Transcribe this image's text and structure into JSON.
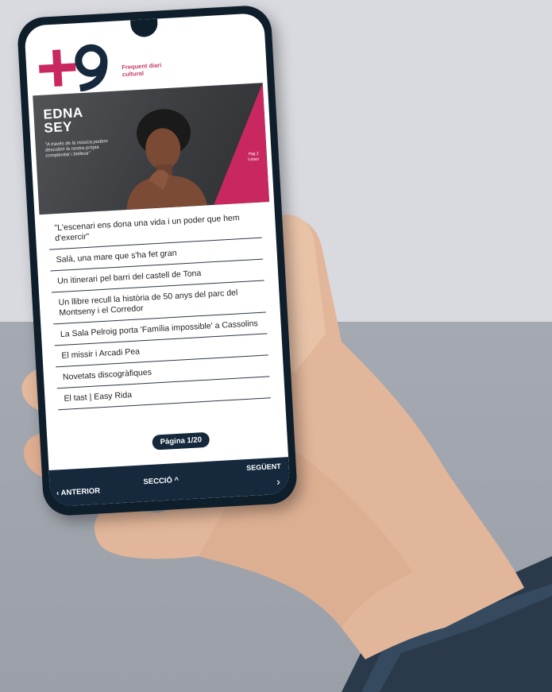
{
  "app": {
    "logo_text": "+9",
    "tagline": "Frequent diari cultural"
  },
  "hero": {
    "name_line1": "EDNA",
    "name_line2": "SEY",
    "quote": "\"A través de la música podem descobrir la nostra pròpia complexitat i bellesa\"",
    "side_text": "Pàg 2 l'ofisió"
  },
  "articles": [
    "\"L'escenari ens dona una vida i un poder que hem d'exercir\"",
    "Salà, una mare que s'ha fet gran",
    "Un itinerari pel barri del castell de Tona",
    "Un llibre recull la història de 50 anys del parc del Montseny i el Corredor",
    "La Sala Pelroig porta 'Família impossible' a Cassolins",
    "El missir i Arcadi Pea",
    "Novetats discogràfiques",
    "El tast | Easy Rida"
  ],
  "pagination": {
    "label": "Pàgina 1/20"
  },
  "nav": {
    "prev": "ANTERIOR",
    "section": "SECCIÓ",
    "next": "SEGÜENT"
  },
  "colors": {
    "brand_pink": "#c8285f",
    "nav_navy": "#15283c",
    "phone_frame": "#0f1e2b"
  }
}
